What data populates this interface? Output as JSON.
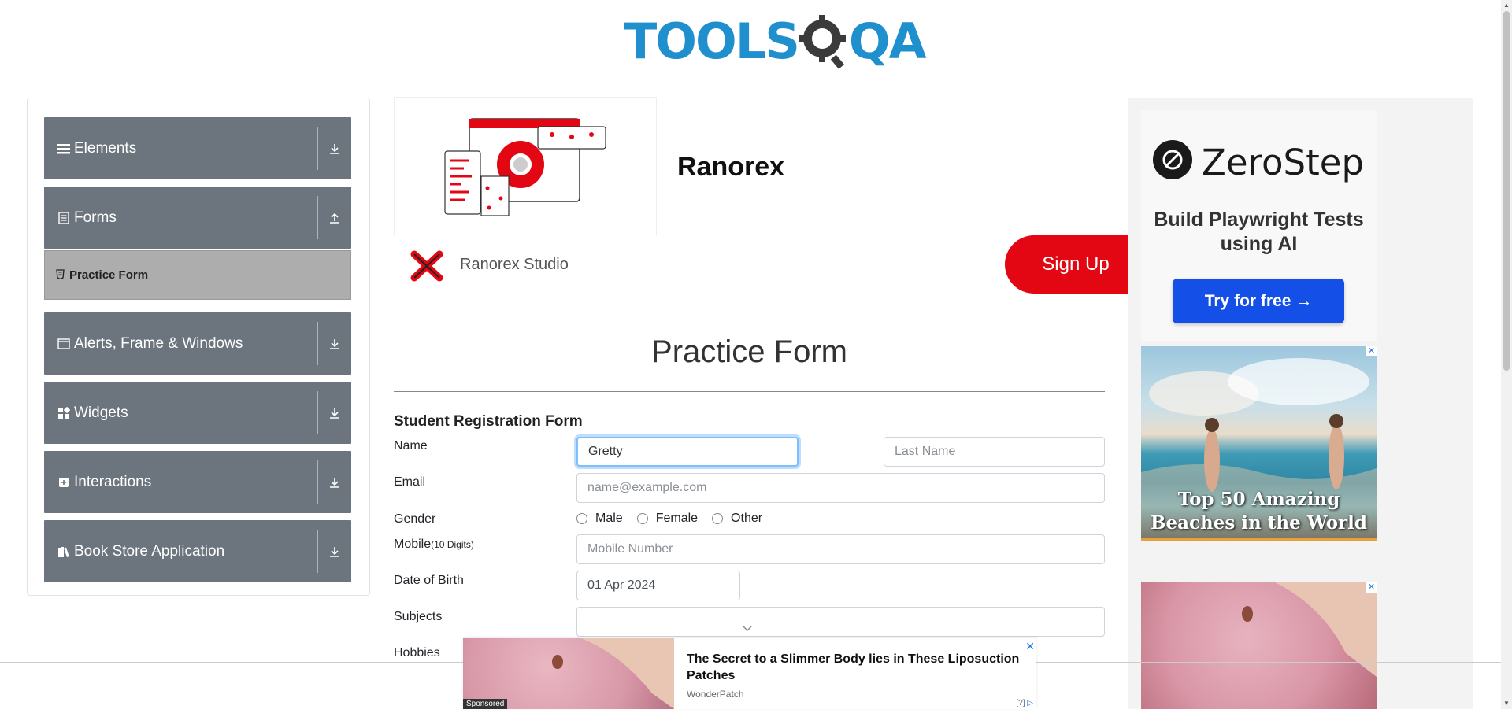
{
  "header": {
    "logo_text_tools": "TOOLS",
    "logo_text_qa": "QA"
  },
  "sidebar": {
    "groups": [
      {
        "label": "Elements",
        "icon": "hamburger-icon",
        "arrow": "download-icon"
      },
      {
        "label": "Forms",
        "icon": "document-icon",
        "arrow": "upload-icon"
      },
      {
        "label": "Alerts, Frame & Windows",
        "icon": "window-icon",
        "arrow": "download-icon"
      },
      {
        "label": "Widgets",
        "icon": "widgets-icon",
        "arrow": "download-icon"
      },
      {
        "label": "Interactions",
        "icon": "interaction-icon",
        "arrow": "download-icon"
      },
      {
        "label": "Book Store Application",
        "icon": "books-icon",
        "arrow": "download-icon"
      }
    ],
    "forms_items": [
      {
        "label": "Practice Form",
        "icon": "form-icon"
      }
    ]
  },
  "ad_banner": {
    "title": "Ranorex",
    "subtitle": "Ranorex Studio",
    "cta": "Sign Up",
    "cta_color": "#e30613"
  },
  "form": {
    "page_title": "Practice Form",
    "section_title": "Student Registration Form",
    "labels": {
      "name": "Name",
      "email": "Email",
      "gender": "Gender",
      "mobile": "Mobile",
      "mobile_hint": "(10 Digits)",
      "dob": "Date of Birth",
      "subjects": "Subjects",
      "hobbies": "Hobbies"
    },
    "first_name_value": "Gretty",
    "last_name_placeholder": "Last Name",
    "email_placeholder": "name@example.com",
    "gender_options": [
      "Male",
      "Female",
      "Other"
    ],
    "mobile_placeholder": "Mobile Number",
    "dob_value": "01 Apr 2024",
    "subjects_value": ""
  },
  "right_ads": {
    "zerostep": {
      "brand": "ZeroStep",
      "tagline": "Build Playwright Tests using AI",
      "cta": "Try for free →",
      "cta_color": "#1450e8"
    },
    "beach": {
      "caption": "Top 50 Amazing Beaches in the World"
    }
  },
  "sticky_ad": {
    "title": "The Secret to a Slimmer Body lies in These Liposuction Patches",
    "brand": "WonderPatch",
    "sponsored": "Sponsored",
    "info": "[?]"
  }
}
